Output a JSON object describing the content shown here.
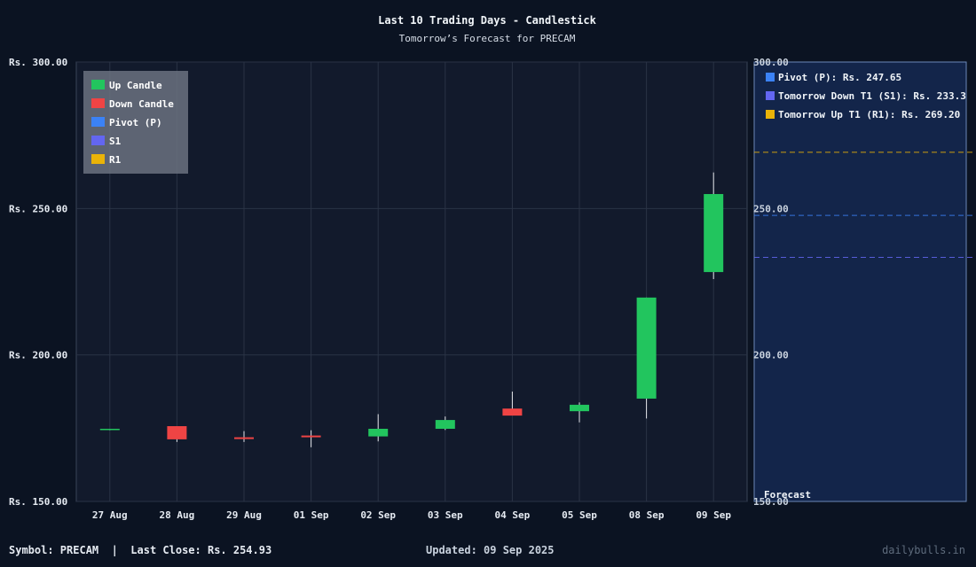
{
  "title": "Last 10 Trading Days - Candlestick",
  "subtitle": "Tomorrow’s Forecast for PRECAM",
  "colors": {
    "background": "#0b1322",
    "plot_bg": "#121a2c",
    "forecast_bg": "#13254a",
    "up": "#22c55e",
    "down": "#ef4444",
    "pivot": "#3b82f6",
    "s1": "#6366f1",
    "r1": "#eab308",
    "grid": "#2a3345"
  },
  "chart_data": {
    "type": "candlestick",
    "categories": [
      "27 Aug",
      "28 Aug",
      "29 Aug",
      "01 Sep",
      "02 Sep",
      "03 Sep",
      "04 Sep",
      "05 Sep",
      "08 Sep",
      "09 Sep"
    ],
    "candles": [
      {
        "date": "27 Aug",
        "open": 174.5,
        "high": 174.7,
        "low": 174.3,
        "close": 174.8
      },
      {
        "date": "28 Aug",
        "open": 175.7,
        "high": 175.7,
        "low": 170.3,
        "close": 171.2
      },
      {
        "date": "29 Aug",
        "open": 171.9,
        "high": 174.0,
        "low": 170.3,
        "close": 171.3
      },
      {
        "date": "01 Sep",
        "open": 172.5,
        "high": 174.3,
        "low": 168.5,
        "close": 171.9
      },
      {
        "date": "02 Sep",
        "open": 172.2,
        "high": 179.8,
        "low": 170.5,
        "close": 174.8
      },
      {
        "date": "03 Sep",
        "open": 174.8,
        "high": 179.0,
        "low": 174.4,
        "close": 177.8
      },
      {
        "date": "04 Sep",
        "open": 181.7,
        "high": 187.5,
        "low": 179.4,
        "close": 179.3
      },
      {
        "date": "05 Sep",
        "open": 180.8,
        "high": 183.8,
        "low": 177.0,
        "close": 183.0
      },
      {
        "date": "08 Sep",
        "open": 185.1,
        "high": 219.6,
        "low": 178.3,
        "close": 219.6
      },
      {
        "date": "09 Sep",
        "open": 228.3,
        "high": 262.3,
        "low": 225.9,
        "close": 254.93
      }
    ],
    "ylim": [
      150,
      300
    ],
    "y_ticks": [
      "Rs. 150.00",
      "Rs. 200.00",
      "Rs. 250.00",
      "Rs. 300.00"
    ],
    "y_tick_values": [
      150,
      200,
      250,
      300
    ],
    "right_ticks": [
      "150.00",
      "200.00",
      "250.00",
      "300.00"
    ],
    "grid": true,
    "legend_placement": "top-left",
    "legend": [
      {
        "label": "Up Candle",
        "color": "#22c55e"
      },
      {
        "label": "Down Candle",
        "color": "#ef4444"
      },
      {
        "label": "Pivot (P)",
        "color": "#3b82f6"
      },
      {
        "label": "S1",
        "color": "#6366f1"
      },
      {
        "label": "R1",
        "color": "#eab308"
      }
    ],
    "forecast": {
      "label": "Forecast",
      "levels": [
        {
          "name": "Pivot (P)",
          "label": "Pivot (P): Rs. 247.65",
          "value": 247.65,
          "color": "#3b82f6"
        },
        {
          "name": "S1",
          "label": "Tomorrow Down T1 (S1): Rs. 233.3",
          "value": 233.3,
          "color": "#6366f1"
        },
        {
          "name": "R1",
          "label": "Tomorrow Up T1 (R1): Rs. 269.20",
          "value": 269.2,
          "color": "#eab308"
        }
      ]
    }
  },
  "footer": {
    "symbol": "Symbol: PRECAM  |  Last Close: Rs. 254.93",
    "updated": "Updated: 09 Sep 2025",
    "brand": "dailybulls.in"
  }
}
